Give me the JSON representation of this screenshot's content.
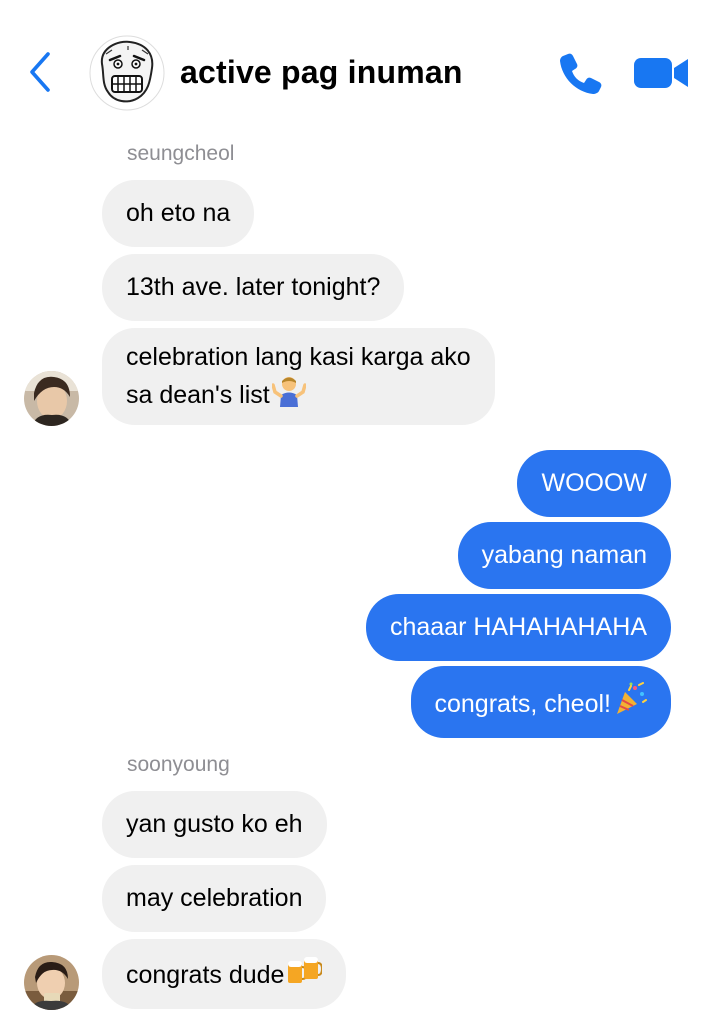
{
  "header": {
    "title": "active pag inuman",
    "back_icon": "chevron-left-icon",
    "call_icon": "phone-icon",
    "video_icon": "video-camera-icon",
    "accent": "#1877F2"
  },
  "messages": [
    {
      "sender": "seungcheol"
    },
    {
      "text": "oh eto na"
    },
    {
      "text": "13th ave. later tonight?"
    },
    {
      "lines": [
        "celebration lang kasi karga ako",
        "sa dean's list"
      ],
      "emoji": "person-shrugging-emoji"
    },
    {
      "text": "WOOOW"
    },
    {
      "text": "yabang naman"
    },
    {
      "text": "chaaar HAHAHAHAHA"
    },
    {
      "text": "congrats, cheol!",
      "emoji": "party-popper-emoji"
    },
    {
      "sender": "soonyoung"
    },
    {
      "text": "yan gusto ko eh"
    },
    {
      "text": "may celebration"
    },
    {
      "text": "congrats dude",
      "emoji": "beer-mugs-emoji"
    }
  ],
  "colors": {
    "incoming_bubble": "#F0F0F0",
    "outgoing_bubble": "#2A75F0",
    "sender_label": "#8E8E93"
  }
}
